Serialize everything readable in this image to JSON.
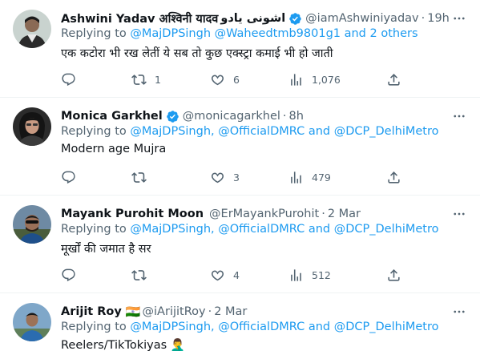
{
  "colors": {
    "accent": "#1d9bf0",
    "muted": "#536471",
    "text": "#0f1419",
    "verified": "#1d9bf0"
  },
  "tweets": [
    {
      "name": "Ashwini Yadav अश्विनी यादव",
      "name_extra": "اشونی یادو",
      "verified": true,
      "handle": "@iamAshwiniyadav",
      "time": "19h",
      "replying_prefix": "Replying to",
      "mentions": "@MajDPSingh @Waheedtmb9801g1  and 2 others",
      "text": "एक कटोरा भी रख लेतीं ये सब तो कुछ एक्स्ट्रा कमाई भी हो जाती",
      "replies": "",
      "retweets": "1",
      "likes": "6",
      "views": "1,076"
    },
    {
      "name": "Monica Garkhel",
      "verified": true,
      "handle": "@monicagarkhel",
      "time": "8h",
      "replying_prefix": "Replying to",
      "mentions": "@MajDPSingh, @OfficialDMRC and @DCP_DelhiMetro",
      "text": "Modern age Mujra",
      "replies": "",
      "retweets": "",
      "likes": "3",
      "views": "479"
    },
    {
      "name": "Mayank Purohit Moon",
      "verified": false,
      "handle": "@ErMayankPurohit",
      "time": "2 Mar",
      "replying_prefix": "Replying to",
      "mentions": "@MajDPSingh, @OfficialDMRC and @DCP_DelhiMetro",
      "text": "मूर्खों की जमात है सर",
      "replies": "",
      "retweets": "",
      "likes": "4",
      "views": "512"
    },
    {
      "name": "Arijit Roy",
      "flag": "🇮🇳",
      "verified": false,
      "handle": "@iArijitRoy",
      "time": "2 Mar",
      "replying_prefix": "Replying to",
      "mentions": "@MajDPSingh, @OfficialDMRC and @DCP_DelhiMetro",
      "text": "Reelers/TikTokiyas 🤦‍♂️"
    }
  ],
  "icons": {
    "reply": "reply-icon",
    "retweet": "retweet-icon",
    "like": "heart-icon",
    "views": "views-icon",
    "share": "share-icon",
    "more": "more-icon",
    "verified": "verified-badge-icon"
  }
}
